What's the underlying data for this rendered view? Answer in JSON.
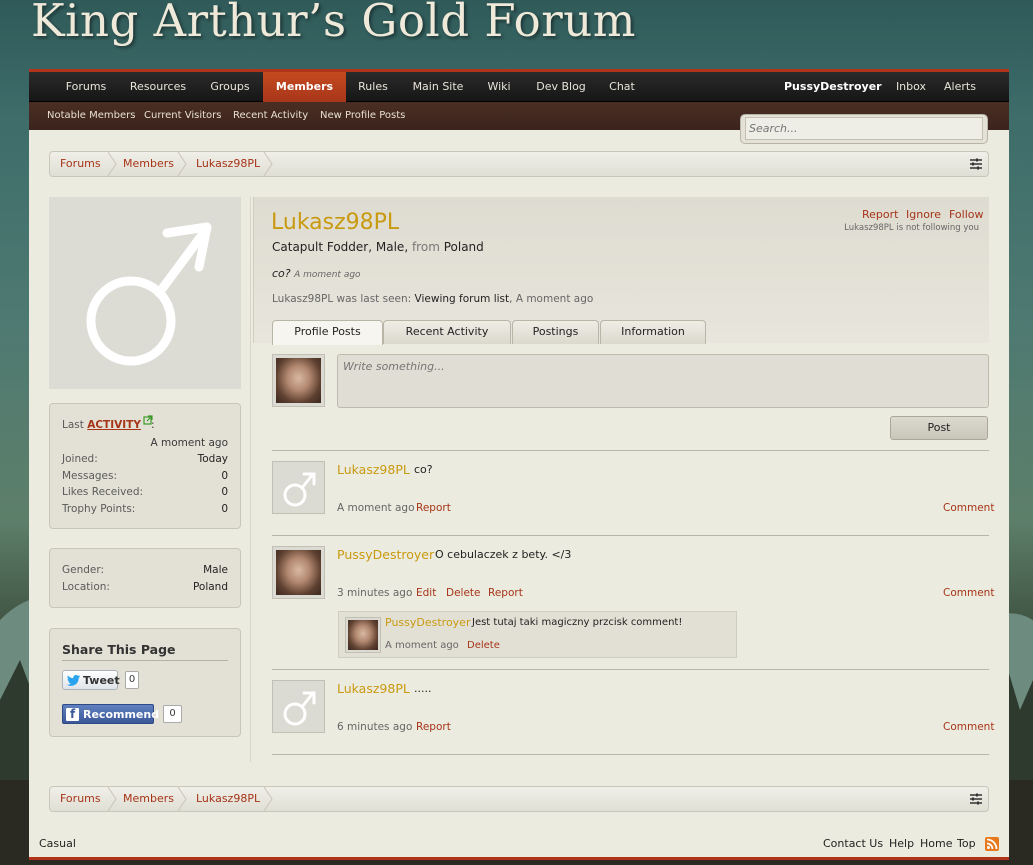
{
  "site": {
    "title": "King Arthur’s Gold Forum"
  },
  "nav": {
    "tabs": [
      "Forums",
      "Resources",
      "Groups",
      "Members",
      "Rules",
      "Main Site",
      "Wiki",
      "Dev Blog",
      "Chat"
    ],
    "selected": "Members",
    "user": "PussyDestroyer",
    "inbox": "Inbox",
    "alerts": "Alerts"
  },
  "subnav": [
    "Notable Members",
    "Current Visitors",
    "Recent Activity",
    "New Profile Posts"
  ],
  "search": {
    "placeholder": "Search..."
  },
  "breadcrumb": [
    "Forums",
    "Members",
    "Lukasz98PL"
  ],
  "profile": {
    "name": "Lukasz98PL",
    "title": "Catapult Fodder",
    "gender": "Male",
    "from_label": "from",
    "location": "Poland",
    "status": "co?",
    "status_time": "A moment ago",
    "last_seen_prefix": "Lukasz98PL was last seen:",
    "last_seen_action": "Viewing forum list",
    "last_seen_time": "A moment ago",
    "actions": {
      "report": "Report",
      "ignore": "Ignore",
      "follow": "Follow"
    },
    "following_note": "Lukasz98PL is not following you"
  },
  "tabs": [
    "Profile Posts",
    "Recent Activity",
    "Postings",
    "Information"
  ],
  "active_tab": "Profile Posts",
  "composer": {
    "placeholder": "Write something...",
    "post_label": "Post"
  },
  "sidebar": {
    "last_activity_label": "Last",
    "activity_link": "ACTIVITY",
    "activity_time": "A moment ago",
    "stats": [
      {
        "k": "Joined:",
        "v": "Today"
      },
      {
        "k": "Messages:",
        "v": "0"
      },
      {
        "k": "Likes Received:",
        "v": "0"
      },
      {
        "k": "Trophy Points:",
        "v": "0"
      }
    ],
    "info": [
      {
        "k": "Gender:",
        "v": "Male"
      },
      {
        "k": "Location:",
        "v": "Poland"
      }
    ],
    "share_title": "Share This Page",
    "tweet": "Tweet",
    "tweet_count": "0",
    "recommend": "Recommend",
    "recommend_count": "0"
  },
  "posts": [
    {
      "author": "Lukasz98PL",
      "text": "co?",
      "time": "A moment ago",
      "actions": [
        "Report"
      ],
      "comment": "Comment"
    },
    {
      "author": "PussyDestroyer",
      "text": "O cebulaczek z bety. </3",
      "time": "3 minutes ago",
      "actions": [
        "Edit",
        "Delete",
        "Report"
      ],
      "comment": "Comment",
      "replies": [
        {
          "author": "PussyDestroyer",
          "text": "Jest tutaj taki magiczny przcisk comment!",
          "time": "A moment ago",
          "action": "Delete"
        }
      ]
    },
    {
      "author": "Lukasz98PL",
      "text": ".....",
      "time": "6 minutes ago",
      "actions": [
        "Report"
      ],
      "comment": "Comment"
    }
  ],
  "footer": {
    "style": "Casual",
    "links": [
      "Contact Us",
      "Help",
      "Home",
      "Top"
    ]
  },
  "colors": {
    "accent": "#a63418",
    "username": "#c99a10",
    "nav_selected": "#b8401c"
  }
}
